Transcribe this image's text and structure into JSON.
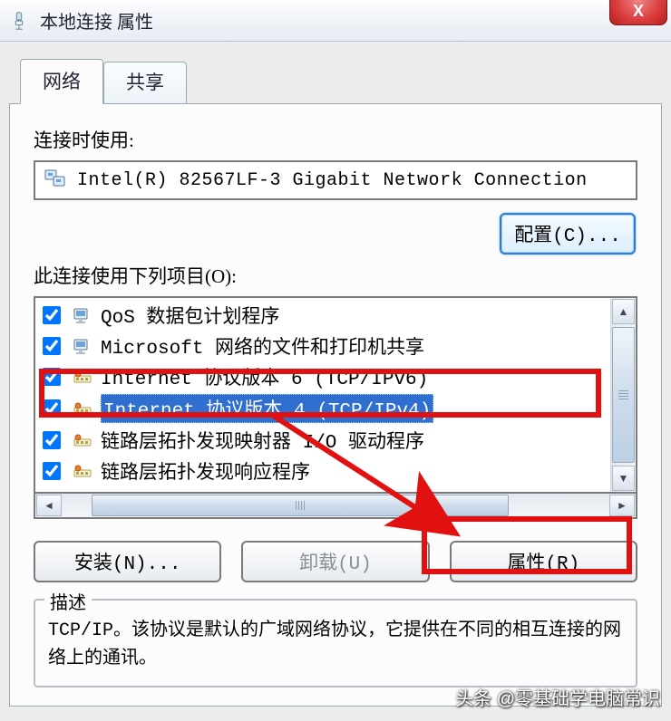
{
  "window": {
    "title": "本地连接 属性",
    "close_glyph": "X"
  },
  "tabs": {
    "network": "网络",
    "sharing": "共享"
  },
  "labels": {
    "connect_using": "连接时使用:",
    "items_used": "此连接使用下列项目(O):",
    "description_title": "描述"
  },
  "adapter": {
    "name": "Intel(R) 82567LF-3 Gigabit Network Connection"
  },
  "buttons": {
    "configure": "配置(C)...",
    "install": "安装(N)...",
    "uninstall": "卸载(U)",
    "properties": "属性(R)"
  },
  "items": [
    {
      "checked": true,
      "icon": "service",
      "label": "QoS 数据包计划程序"
    },
    {
      "checked": true,
      "icon": "service",
      "label": "Microsoft 网络的文件和打印机共享"
    },
    {
      "checked": true,
      "icon": "protocol",
      "label": "Internet 协议版本 6 (TCP/IPv6)"
    },
    {
      "checked": true,
      "icon": "protocol",
      "label": "Internet 协议版本 4 (TCP/IPv4)",
      "selected": true
    },
    {
      "checked": true,
      "icon": "protocol",
      "label": "链路层拓扑发现映射器 I/O 驱动程序"
    },
    {
      "checked": true,
      "icon": "protocol",
      "label": "链路层拓扑发现响应程序"
    }
  ],
  "description": {
    "text": "TCP/IP。该协议是默认的广域网络协议，它提供在不同的相互连接的网络上的通讯。"
  },
  "watermark": "头条 @零基础学电脑常识"
}
